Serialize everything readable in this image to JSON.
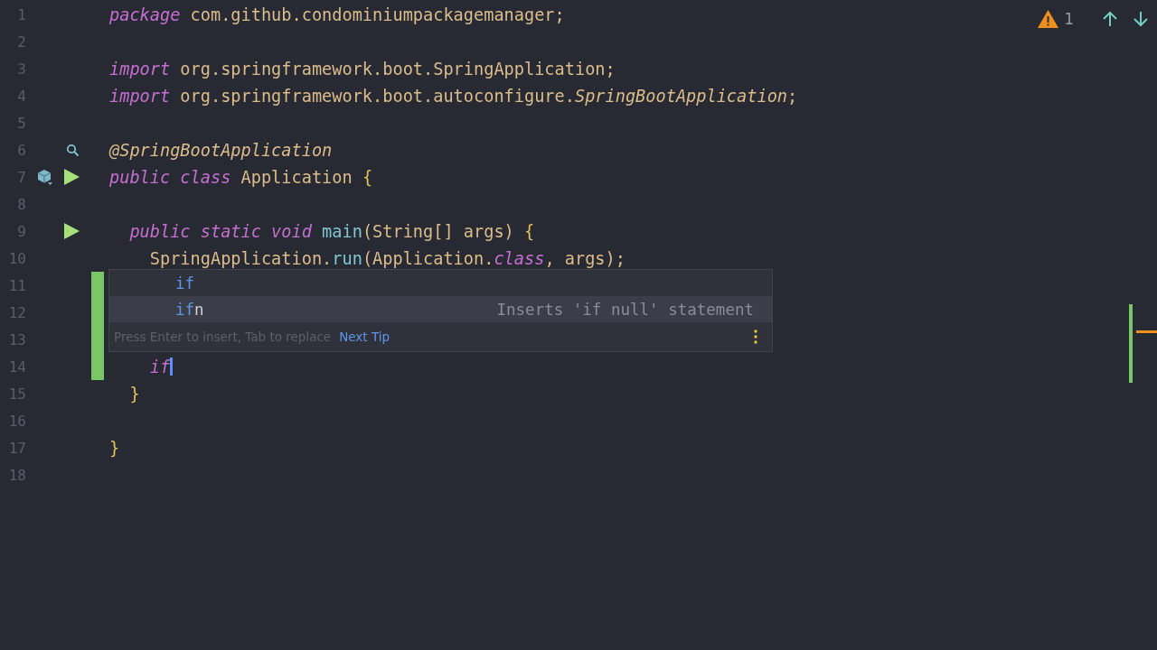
{
  "inspections": {
    "warnings": "1"
  },
  "lines": [
    {
      "number": "1",
      "changed": false,
      "tokens": [
        {
          "kind": "keyword",
          "text": "package"
        },
        {
          "kind": "plain",
          "text": " com.github.condominiumpackagemanager;"
        }
      ]
    },
    {
      "number": "2",
      "changed": false
    },
    {
      "number": "3",
      "changed": false,
      "tokens": [
        {
          "kind": "keyword",
          "text": "import"
        },
        {
          "kind": "plain",
          "text": " org.springframework.boot.SpringApplication;"
        }
      ]
    },
    {
      "number": "4",
      "changed": false,
      "tokens": [
        {
          "kind": "keyword",
          "text": "import"
        },
        {
          "kind": "plain",
          "text": " org.springframework.boot.autoconfigure."
        },
        {
          "kind": "italic",
          "text": "SpringBootApplication"
        },
        {
          "kind": "plain",
          "text": ";"
        }
      ]
    },
    {
      "number": "5",
      "changed": false
    },
    {
      "number": "6",
      "changed": false,
      "gutter": [
        {
          "kind": "search"
        }
      ],
      "tokens": [
        {
          "kind": "italic",
          "text": "@SpringBootApplication"
        }
      ]
    },
    {
      "number": "7",
      "changed": false,
      "gutter": [
        {
          "kind": "bean"
        },
        {
          "kind": "run"
        }
      ],
      "tokens": [
        {
          "kind": "keyword",
          "text": "public class"
        },
        {
          "kind": "plain",
          "text": " Application "
        },
        {
          "kind": "brace",
          "text": "{"
        }
      ]
    },
    {
      "number": "8",
      "changed": false
    },
    {
      "number": "9",
      "changed": false,
      "gutter": [
        {
          "kind": "run"
        }
      ],
      "tokens": [
        {
          "kind": "keyword",
          "text": "  public static void "
        },
        {
          "kind": "method",
          "text": "main"
        },
        {
          "kind": "plain",
          "text": "(String[] args) "
        },
        {
          "kind": "brace",
          "text": "{"
        }
      ]
    },
    {
      "number": "10",
      "changed": false,
      "tokens": [
        {
          "kind": "plain",
          "text": "    SpringApplication."
        },
        {
          "kind": "method",
          "text": "run"
        },
        {
          "kind": "plain",
          "text": "(Application."
        },
        {
          "kind": "keyword",
          "text": "class"
        },
        {
          "kind": "plain",
          "text": ", args);"
        }
      ]
    },
    {
      "number": "11",
      "changed": true
    },
    {
      "number": "12",
      "changed": true
    },
    {
      "number": "13",
      "changed": true
    },
    {
      "number": "14",
      "changed": true,
      "caret": true,
      "tokens": [
        {
          "kind": "keyword",
          "text": "    if"
        }
      ]
    },
    {
      "number": "15",
      "changed": false,
      "tokens": [
        {
          "kind": "brace",
          "text": "  }"
        }
      ]
    },
    {
      "number": "16",
      "changed": false
    },
    {
      "number": "17",
      "changed": false,
      "tokens": [
        {
          "kind": "brace",
          "text": "}"
        }
      ]
    },
    {
      "number": "18",
      "changed": false
    }
  ],
  "completion": {
    "items": [
      {
        "match": "if",
        "selected": false
      },
      {
        "match": "if",
        "rest": "n",
        "hint": "Inserts 'if null' statement",
        "selected": true
      }
    ],
    "footer": "Press Enter to insert, Tab to replace",
    "link": "Next Tip"
  }
}
